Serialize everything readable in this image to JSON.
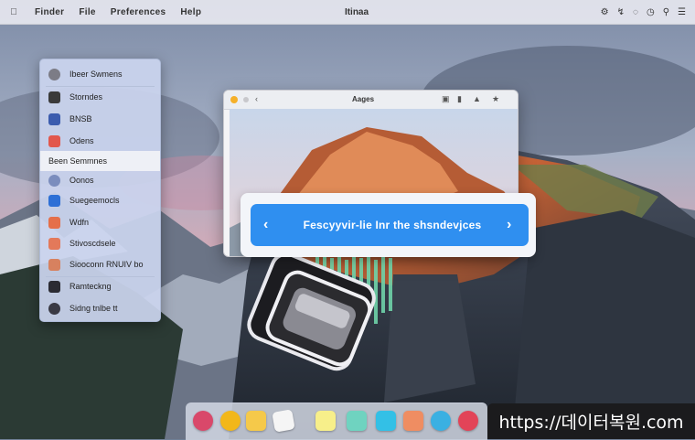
{
  "menubar": {
    "apple_icon": "apple-icon",
    "items": [
      "Finder",
      "File",
      "Preferences",
      "Help"
    ],
    "center_title": "Itinaa",
    "status_icons": [
      "control-icon",
      "bluetooth-icon",
      "wifi-icon",
      "clock-icon",
      "search-icon",
      "notification-icon"
    ]
  },
  "sidebar": {
    "items": [
      {
        "label": "Ibeer Swmens",
        "icon": "apple-icon",
        "color": "#7c7c86"
      },
      {
        "label": "Storndes",
        "icon": "display-icon",
        "color": "#3a3a3a"
      },
      {
        "label": "BNSB",
        "icon": "network-icon",
        "color": "#3b5cae"
      },
      {
        "label": "Odens",
        "icon": "bell-icon",
        "color": "#e2574c"
      },
      {
        "label": "Been Semmnes",
        "icon": "",
        "color": "",
        "selected": true
      },
      {
        "label": "Oonos",
        "icon": "globe-icon",
        "color": "#7b8dbd"
      },
      {
        "label": "Suegeemocls",
        "icon": "phone-icon",
        "color": "#2d6fd6"
      },
      {
        "label": "Wdfn",
        "icon": "folder-icon",
        "color": "#e56f4a"
      },
      {
        "label": "Stivoscdsele",
        "icon": "card-icon",
        "color": "#e3795a"
      },
      {
        "label": "Siooconn RNUIV bo",
        "icon": "envelope-icon",
        "color": "#d7815f"
      },
      {
        "label": "Ramteckng",
        "icon": "tablet-icon",
        "color": "#2b2b33"
      },
      {
        "label": "Sidng tnlbe tt",
        "icon": "gauge-icon",
        "color": "#3a3a44"
      }
    ]
  },
  "window": {
    "title": "Aages",
    "toolbar_icons": [
      "back-icon",
      "forward-icon",
      "share-icon",
      "trash-icon",
      "star-icon"
    ]
  },
  "banner": {
    "message": "Fescyyvir-lie Inr the shsndevjces",
    "prev_icon": "chevron-left-icon",
    "next_icon": "chevron-right-icon",
    "color": "#2f8ff0"
  },
  "dock": {
    "icons": [
      {
        "name": "launchpad-icon",
        "color": "#d9486a"
      },
      {
        "name": "safari-icon",
        "color": "#f2b71a"
      },
      {
        "name": "notes-icon",
        "color": "#f5c94a"
      },
      {
        "name": "paper-icon",
        "color": "#f5f5f5"
      },
      {
        "name": "sticky-icon",
        "color": "#f7ef8a"
      },
      {
        "name": "mail-icon",
        "color": "#6fd3c0"
      },
      {
        "name": "finder-icon",
        "color": "#33c0e6"
      },
      {
        "name": "photos-icon",
        "color": "#ef8d62"
      },
      {
        "name": "messages-icon",
        "color": "#3ab0e2"
      },
      {
        "name": "music-icon",
        "color": "#e24458"
      }
    ]
  },
  "watermark": "https://데이터복원.com"
}
